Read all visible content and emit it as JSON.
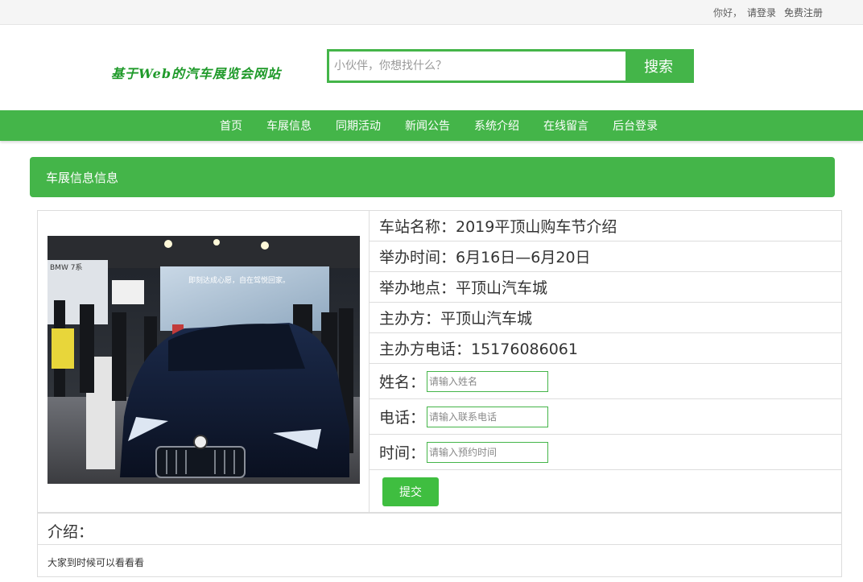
{
  "topbar": {
    "greeting": "你好，",
    "login": "请登录",
    "register": "免费注册"
  },
  "logo": {
    "text": "基于Web的汽车展览会网站"
  },
  "search": {
    "placeholder": "小伙伴，你想找什么？",
    "button": "搜索"
  },
  "nav": {
    "items": [
      "首页",
      "车展信息",
      "同期活动",
      "新闻公告",
      "系统介绍",
      "在线留言",
      "后台登录"
    ]
  },
  "section": {
    "title": "车展信息信息"
  },
  "detail": {
    "name": "车站名称：2019平顶山购车节介绍",
    "time": "举办时间：6月16日—6月20日",
    "place": "举办地点：平顶山汽车城",
    "organizer": "主办方：平顶山汽车城",
    "phone": "主办方电话：15176086061"
  },
  "form": {
    "name_label": "姓名：",
    "name_placeholder": "请输入姓名",
    "phone_label": "电话：",
    "phone_placeholder": "请输入联系电话",
    "time_label": "时间：",
    "time_placeholder": "请输入预约时间",
    "submit": "提交"
  },
  "intro": {
    "label": "介绍：",
    "text": "大家到时候可以看看看"
  },
  "photo": {
    "banner_text": "即刻达成心愿，自在驾悦回家。",
    "side_text": "BMW 7系"
  },
  "colors": {
    "brand_green": "#44b549",
    "logo_green": "#1f9a2a"
  }
}
